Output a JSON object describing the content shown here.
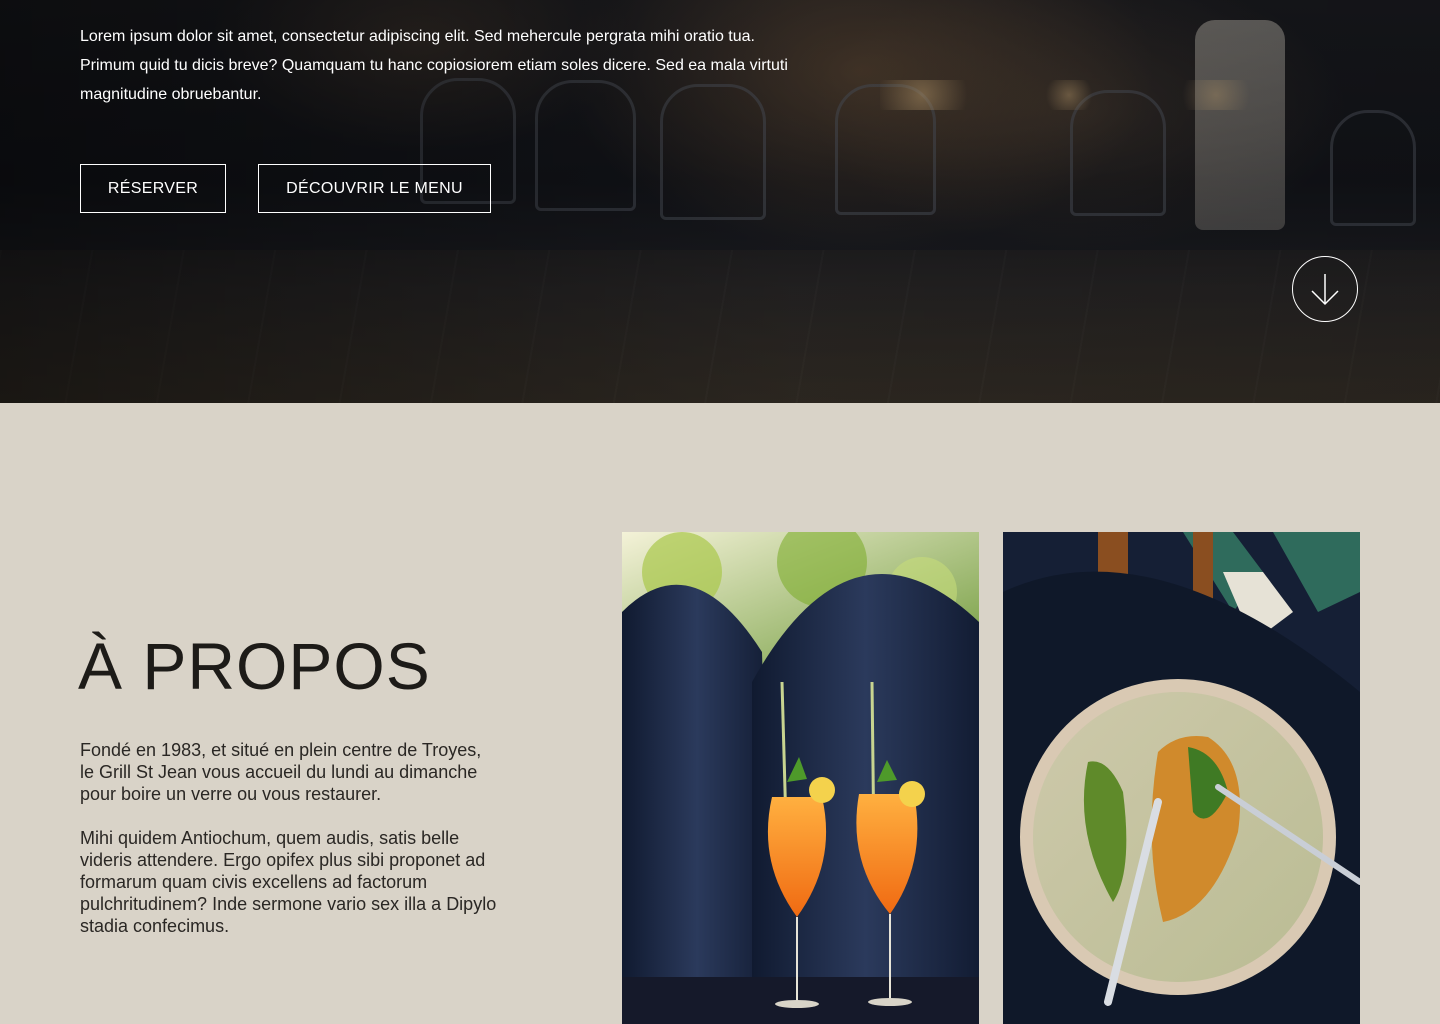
{
  "hero": {
    "intro_text": "Lorem ipsum dolor sit amet, consectetur adipiscing elit. Sed mehercule pergrata mihi oratio tua. Primum quid tu dicis breve? Quamquam tu hanc copiosiorem etiam soles dicere. Sed ea mala virtuti magnitudine obruebantur.",
    "reserve_button": "RÉSERVER",
    "menu_button": "DÉCOUVRIR LE MENU",
    "scroll_icon": "arrow-down-icon",
    "background_image": "restaurant-terrace-crowd"
  },
  "about": {
    "title": "À PROPOS",
    "paragraph1": "Fondé en 1983, et situé en plein centre de Troyes, le Grill St Jean vous accueil du lundi au dimanche pour boire un verre ou vous restaurer.",
    "paragraph2": "Mihi quidem Antiochum, quem audis, satis belle videris attendere. Ergo opifex plus sibi proponet ad formarum quam civis excellens ad factorum pulchritudinem? Inde sermone vario sex illa a Dipylo stadia confecimus.",
    "images": [
      "orange-cocktails-photo",
      "fish-plate-photo"
    ]
  },
  "colors": {
    "section_bg": "#d9d3c8",
    "text_dark": "#1d1b18",
    "hero_text": "#ffffff",
    "navy_banquette": "#1d2a44"
  }
}
